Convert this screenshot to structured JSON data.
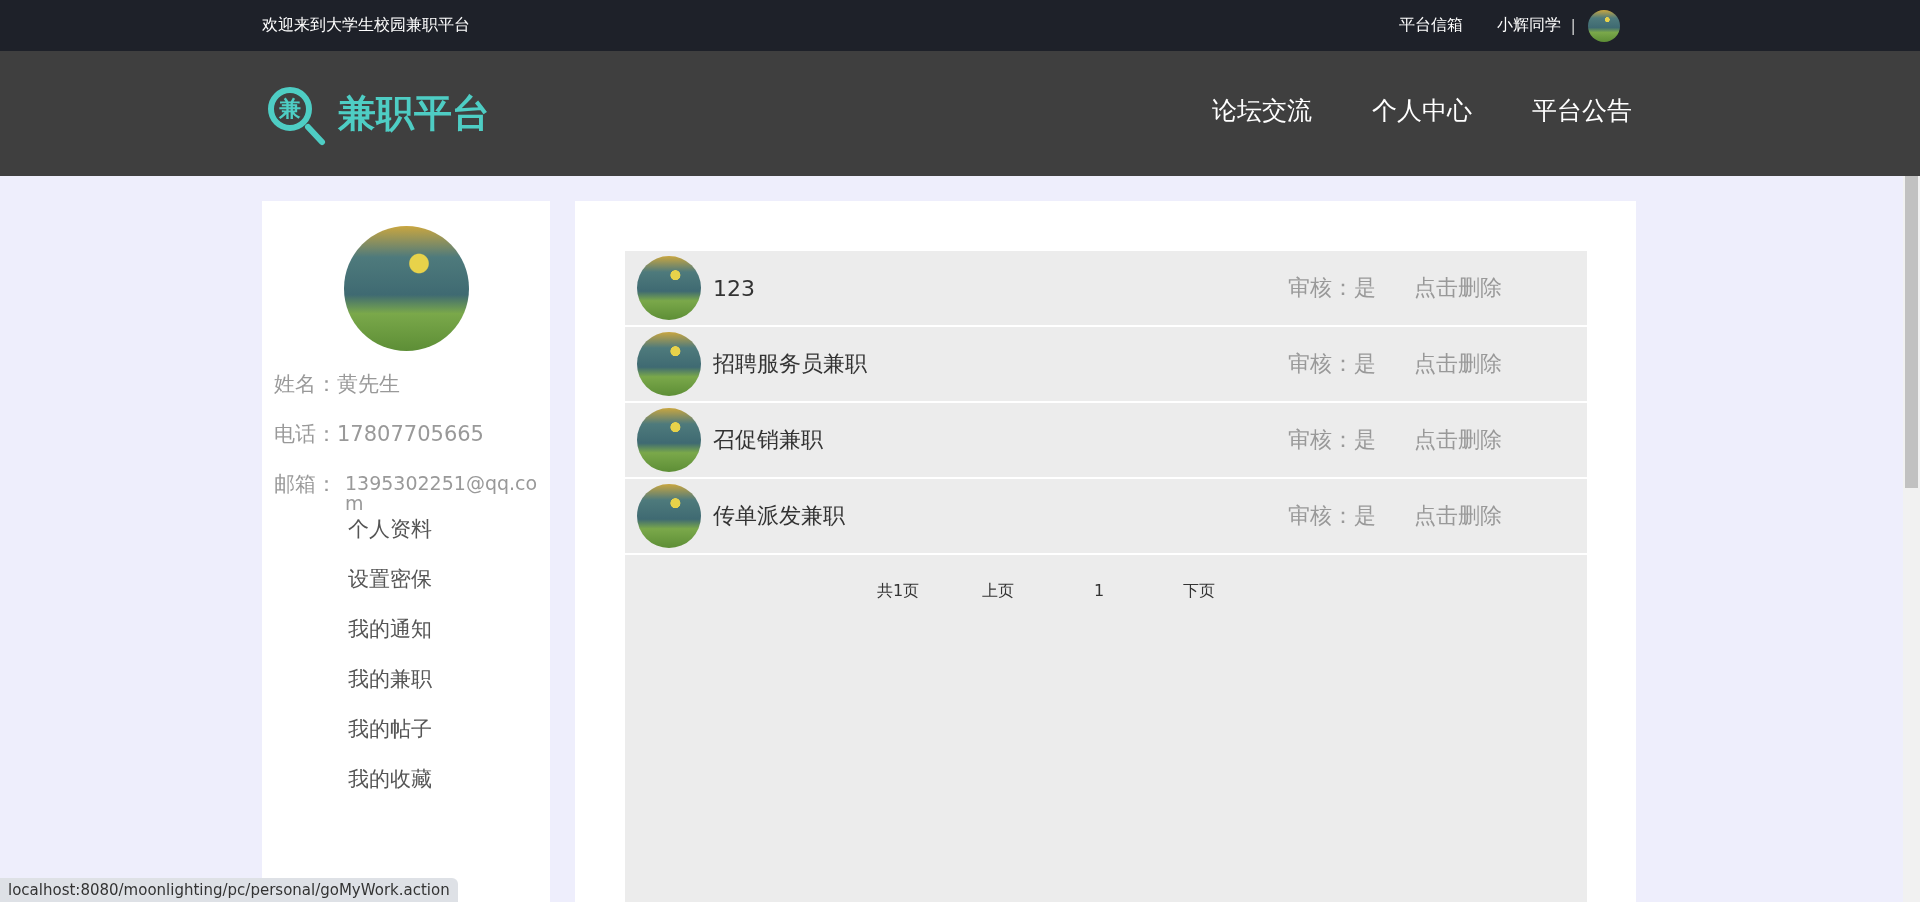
{
  "top_bar": {
    "welcome": "欢迎来到大学生校园兼职平台",
    "links": [
      "平台信箱",
      "小辉同学"
    ],
    "separator": "|"
  },
  "header": {
    "logo_glyph": "兼",
    "logo_text": "兼职平台",
    "nav": [
      {
        "label": "论坛交流",
        "selected": false
      },
      {
        "label": "个人中心",
        "selected": false
      },
      {
        "label": "平台公告",
        "selected": false
      }
    ]
  },
  "profile": {
    "fields": [
      {
        "label": "姓名：",
        "value": "黄先生"
      },
      {
        "label": "电话：",
        "value": "17807705665"
      },
      {
        "label": "邮箱：",
        "value": "1395302251@qq.com"
      }
    ],
    "menu": [
      "个人资料",
      "设置密保",
      "我的通知",
      "我的兼职",
      "我的帖子",
      "我的收藏"
    ]
  },
  "jobs": [
    {
      "title": "123",
      "status": "审核：是",
      "action": "点击删除"
    },
    {
      "title": "招聘服务员兼职",
      "status": "审核：是",
      "action": "点击删除"
    },
    {
      "title": "召促销兼职",
      "status": "审核：是",
      "action": "点击删除"
    },
    {
      "title": "传单派发兼职",
      "status": "审核：是",
      "action": "点击删除"
    }
  ],
  "pagination": {
    "total": "共1页",
    "prev": "上页",
    "current": "1",
    "next": "下页"
  },
  "status_bar": "localhost:8080/moonlighting/pc/personal/goMyWork.action"
}
